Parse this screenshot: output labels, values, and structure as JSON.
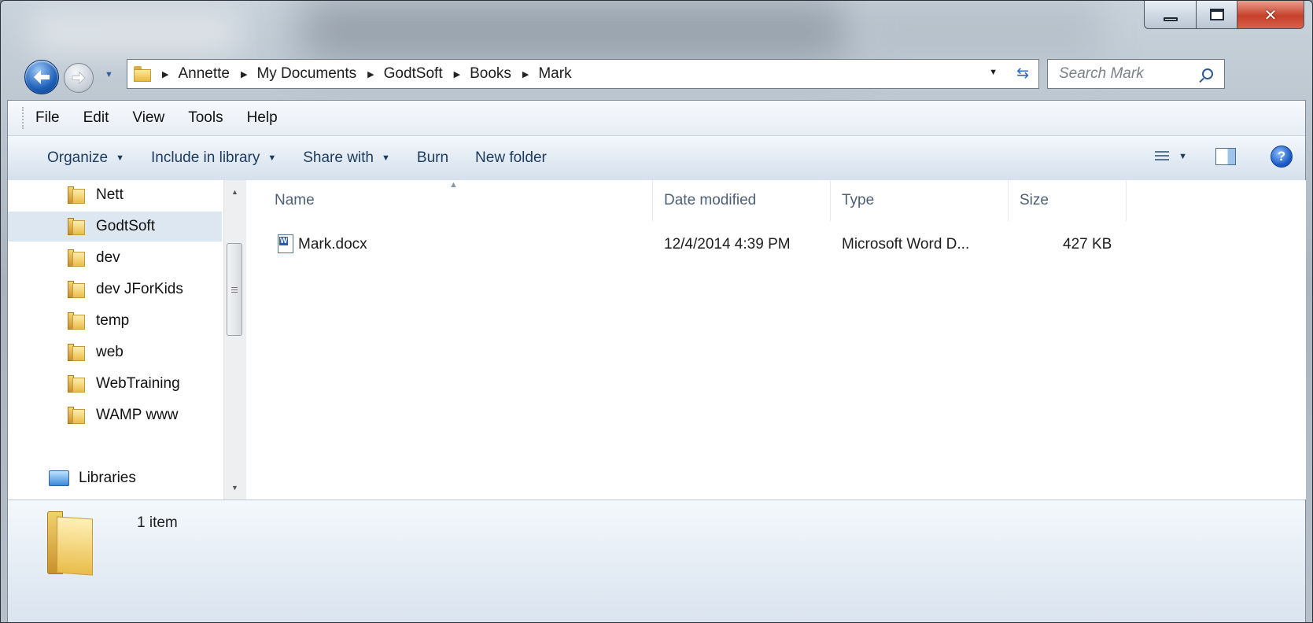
{
  "window": {
    "controls": [
      "minimize",
      "maximize",
      "close"
    ]
  },
  "navigation": {
    "breadcrumb": [
      "Annette",
      "My Documents",
      "GodtSoft",
      "Books",
      "Mark"
    ],
    "search_placeholder": "Search Mark"
  },
  "menu": {
    "file": "File",
    "edit": "Edit",
    "view": "View",
    "tools": "Tools",
    "help": "Help"
  },
  "toolbar": {
    "organize": "Organize",
    "include_in_library": "Include in library",
    "share_with": "Share with",
    "burn": "Burn",
    "new_folder": "New folder"
  },
  "sidebar": {
    "items": [
      {
        "label": "Nett",
        "icon": "folder-icon"
      },
      {
        "label": "GodtSoft",
        "icon": "folder-icon",
        "selected": true
      },
      {
        "label": "dev",
        "icon": "folder-icon"
      },
      {
        "label": "dev JForKids",
        "icon": "folder-icon"
      },
      {
        "label": "temp",
        "icon": "folder-icon"
      },
      {
        "label": "web",
        "icon": "folder-icon"
      },
      {
        "label": "WebTraining",
        "icon": "folder-icon"
      },
      {
        "label": "WAMP www",
        "icon": "folder-icon"
      }
    ],
    "libraries": "Libraries"
  },
  "file_list": {
    "columns": [
      "Name",
      "Date modified",
      "Type",
      "Size"
    ],
    "rows": [
      {
        "name": "Mark.docx",
        "date_modified": "12/4/2014 4:39 PM",
        "type": "Microsoft Word D...",
        "size": "427 KB",
        "icon": "word-document-icon"
      }
    ]
  },
  "status": {
    "item_count": "1 item"
  }
}
